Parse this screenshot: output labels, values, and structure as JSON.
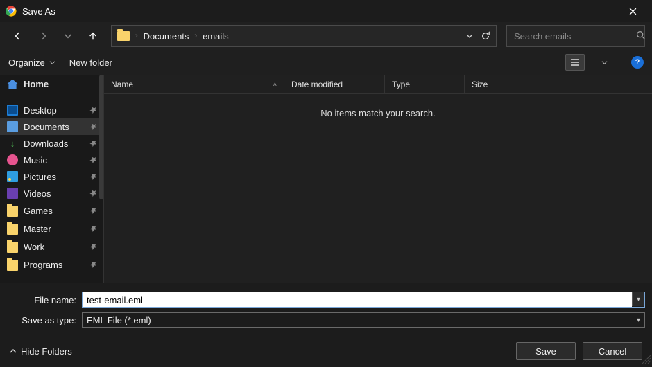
{
  "window": {
    "title": "Save As"
  },
  "breadcrumb": {
    "seg1": "Documents",
    "seg2": "emails"
  },
  "search": {
    "placeholder": "Search emails"
  },
  "toolbar": {
    "organize": "Organize",
    "newfolder": "New folder"
  },
  "sidebar": {
    "home": "Home",
    "items": [
      {
        "label": "Desktop",
        "icon": "desktop"
      },
      {
        "label": "Documents",
        "icon": "doc",
        "selected": true
      },
      {
        "label": "Downloads",
        "icon": "down"
      },
      {
        "label": "Music",
        "icon": "music"
      },
      {
        "label": "Pictures",
        "icon": "pic"
      },
      {
        "label": "Videos",
        "icon": "vid"
      },
      {
        "label": "Games",
        "icon": "folder"
      },
      {
        "label": "Master",
        "icon": "folder"
      },
      {
        "label": "Work",
        "icon": "folder"
      },
      {
        "label": "Programs",
        "icon": "folder"
      }
    ]
  },
  "columns": {
    "name": "Name",
    "date": "Date modified",
    "type": "Type",
    "size": "Size"
  },
  "content": {
    "empty": "No items match your search."
  },
  "fields": {
    "filename_label": "File name:",
    "filename_value": "test-email.eml",
    "savetype_label": "Save as type:",
    "savetype_value": "EML File (*.eml)"
  },
  "footer": {
    "hide": "Hide Folders",
    "save": "Save",
    "cancel": "Cancel"
  }
}
